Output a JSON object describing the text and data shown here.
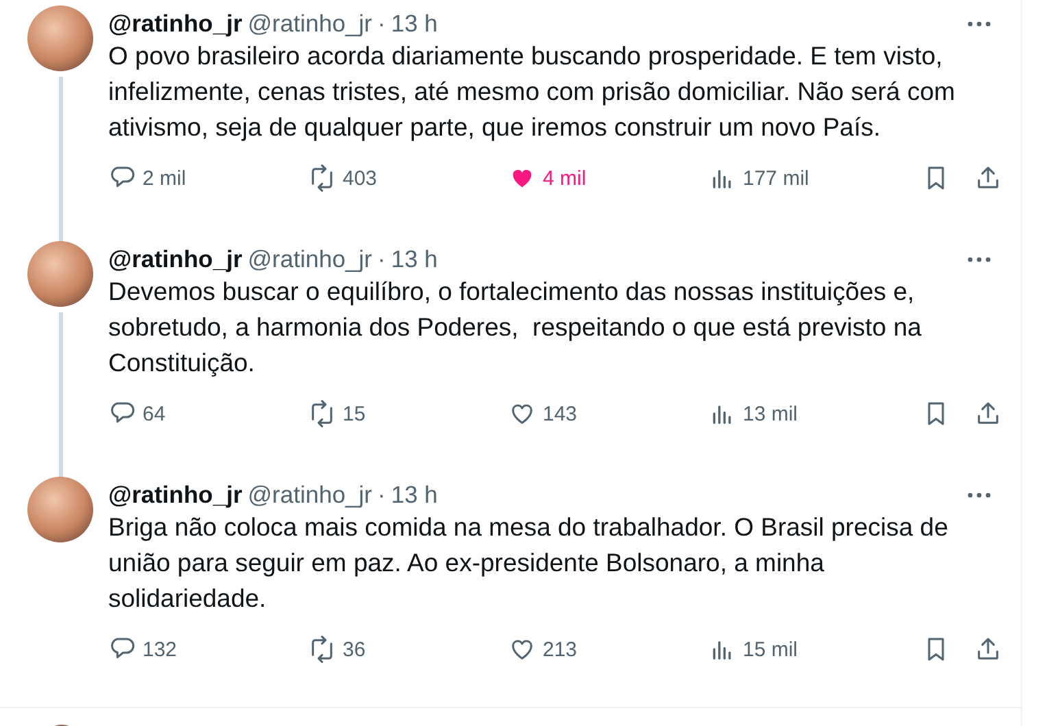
{
  "tweets": [
    {
      "display_name": "@ratinho_jr",
      "handle": "@ratinho_jr",
      "separator": "·",
      "time": "13 h",
      "thread_continues": true,
      "text": "O povo brasileiro acorda diariamente buscando prosperidade. E tem visto,\ninfelizmente, cenas tristes, até mesmo com prisão domiciliar. Não será com\nativismo, seja de qualquer parte, que iremos construir um novo País.",
      "replies": "2 mil",
      "reposts": "403",
      "likes": "4 mil",
      "liked": true,
      "views": "177 mil"
    },
    {
      "display_name": "@ratinho_jr",
      "handle": "@ratinho_jr",
      "separator": "·",
      "time": "13 h",
      "thread_continues": true,
      "text": "Devemos buscar o equilíbro, o fortalecimento das nossas instituições e,\nsobretudo, a harmonia dos Poderes,  respeitando o que está previsto na\nConstituição.",
      "replies": "64",
      "reposts": "15",
      "likes": "143",
      "liked": false,
      "views": "13 mil"
    },
    {
      "display_name": "@ratinho_jr",
      "handle": "@ratinho_jr",
      "separator": "·",
      "time": "13 h",
      "thread_continues": false,
      "text": "Briga não coloca mais comida na mesa do trabalhador. O Brasil precisa de\nunião para seguir em paz. Ao ex-presidente Bolsonaro, a minha\nsolidariedade.",
      "replies": "132",
      "reposts": "36",
      "likes": "213",
      "liked": false,
      "views": "15 mil"
    }
  ]
}
